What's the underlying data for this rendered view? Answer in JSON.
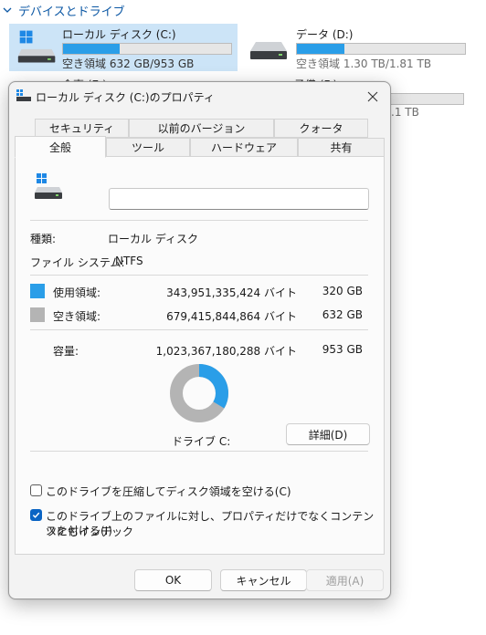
{
  "explorer": {
    "section_title": "デバイスとドライブ",
    "drives": [
      {
        "name": "ローカル ディスク (C:)",
        "space": "空き領域 632 GB/953 GB",
        "used_fraction": 0.337
      },
      {
        "name": "データ (D:)",
        "space": "空き領域 1.30 TB/1.81 TB",
        "used_fraction": 0.282
      }
    ],
    "peek_left": "会事 (E:)",
    "peek_right": "予備 (F:)",
    "peek_right_tail": ".1 TB"
  },
  "dialog": {
    "title": "ローカル ディスク (C:)のプロパティ",
    "tabs_back": [
      "セキュリティ",
      "以前のバージョン",
      "クォータ"
    ],
    "tabs_front": [
      "全般",
      "ツール",
      "ハードウェア",
      "共有"
    ],
    "active_tab": "全般",
    "name_value": "",
    "type_label": "種類:",
    "type_value": "ローカル ディスク",
    "fs_label": "ファイル システム:",
    "fs_value": "NTFS",
    "used_label": "使用領域:",
    "used_bytes": "343,951,335,424 バイト",
    "used_gb": "320 GB",
    "free_label": "空き領域:",
    "free_bytes": "679,415,844,864 バイト",
    "free_gb": "632 GB",
    "capacity_label": "容量:",
    "capacity_bytes": "1,023,367,180,288 バイト",
    "capacity_gb": "953 GB",
    "used_fraction": 0.336,
    "drive_label": "ドライブ C:",
    "details_button": "詳細(D)",
    "compress_label": "このドライブを圧縮してディスク領域を空ける(C)",
    "compress_checked": false,
    "index_label_line1": "このドライブ上のファイルに対し、プロパティだけでなくコンテンツにもインデック",
    "index_label_line2": "スを付ける(I)",
    "index_checked": true,
    "ok_button": "OK",
    "cancel_button": "キャンセル",
    "apply_button": "適用(A)"
  },
  "colors": {
    "used": "#2a9ee8",
    "free": "#b4b4b4",
    "accent": "#0a64c4",
    "selection": "#cce4f7"
  }
}
